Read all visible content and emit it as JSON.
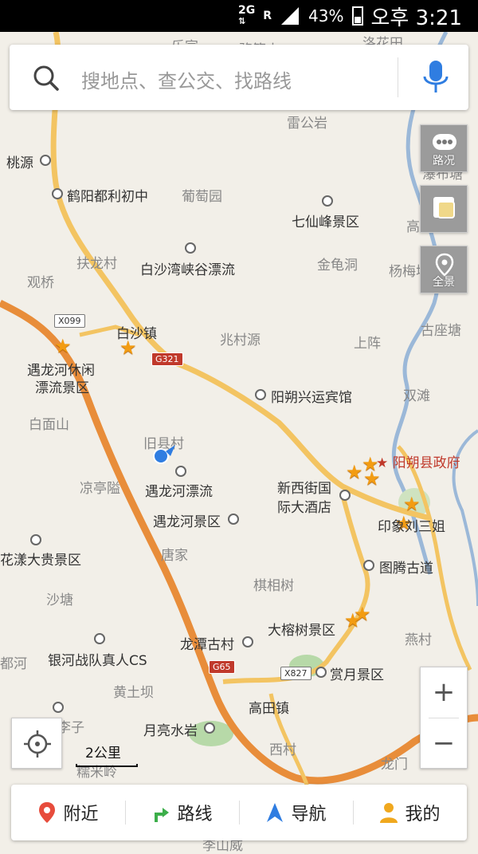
{
  "status": {
    "network": "2G",
    "roaming": "R",
    "battery": "43%",
    "time": "오후 3:21"
  },
  "search": {
    "placeholder": "搜地点、查公交、找路线"
  },
  "side_buttons": {
    "traffic": "路况",
    "layers": "",
    "panorama": "全景"
  },
  "scale": {
    "label": "2公里"
  },
  "zoom": {
    "in": "+",
    "out": "−"
  },
  "nav": [
    {
      "label": "附近",
      "icon": "location-pin-icon"
    },
    {
      "label": "路线",
      "icon": "route-arrow-icon"
    },
    {
      "label": "导航",
      "icon": "navigation-arrow-icon"
    },
    {
      "label": "我的",
      "icon": "person-icon"
    }
  ],
  "map": {
    "places": {
      "lexuan": "乐宣",
      "luobei": "骆筚山",
      "luohuatian": "洛花田",
      "leigongyan": "雷公岩",
      "taoyuan": "桃源",
      "hengyang": "鹤阳都利初中",
      "putaoyuan": "葡萄园",
      "qixianfeng": "七仙峰景区",
      "pubutang": "瀑布塘",
      "gaozhoucun": "高洲村",
      "fulongcun": "扶龙村",
      "baishawan": "白沙湾峡谷漂流",
      "jinguidong": "金龟洞",
      "yangmeiping": "杨梅坪",
      "guanqiao": "观桥",
      "baishazhen": "白沙镇",
      "zhaocunyuan": "兆村源",
      "shangzhen": "上阵",
      "guzuotang": "古座塘",
      "yulonghe_xiuxian": "遇龙河休闲",
      "piaoliu_jingqu": "漂流景区",
      "yangshuo_hotel": "阳朔兴运宾馆",
      "shuangtan": "双滩",
      "baimianshan": "白面山",
      "jiuxiancun": "旧县村",
      "yangshuo_gov": "阳朔县政府",
      "yulonghe_piaoliu": "遇龙河漂流",
      "xinxijie1": "新西街国",
      "xinxijie2": "际大酒店",
      "liangtingai": "凉亭隘",
      "yulonghe_jingqu": "遇龙河景区",
      "yinxiang": "印象刘三姐",
      "tangjia": "唐家",
      "huayang": "花漾大贵景区",
      "tuteng": "图腾古道",
      "qixiangshu": "棋相树",
      "shatang": "沙塘",
      "darongshu": "大榕树景区",
      "longtan": "龙潭古村",
      "yanchun": "燕村",
      "duhe": "都河",
      "yinhe": "银河战队真人CS",
      "shangyue": "赏月景区",
      "huangtuba": "黄土坝",
      "gaotianzhen": "高田镇",
      "yueliang": "月亮水岩",
      "xicun": "西村",
      "longmen": "龙门",
      "nuomiling": "糯米岭",
      "luzi": "李子",
      "lizishan": "李山威"
    },
    "roads": {
      "g321": "G321",
      "x099": "X099",
      "g65": "G65",
      "x827": "X827"
    }
  }
}
